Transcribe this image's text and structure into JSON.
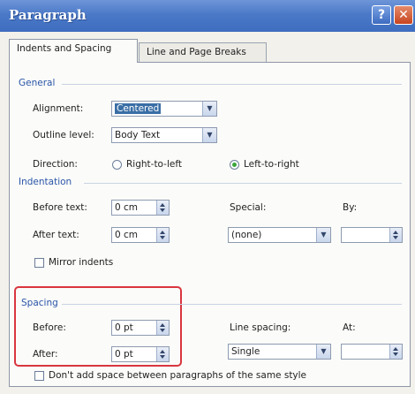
{
  "window": {
    "title": "Paragraph",
    "help_glyph": "?",
    "close_glyph": "✕"
  },
  "tabs": [
    {
      "label": "Indents and Spacing",
      "active": true
    },
    {
      "label": "Line and Page Breaks",
      "active": false
    }
  ],
  "general": {
    "title": "General",
    "alignment_label": "Alignment:",
    "alignment_value": "Centered",
    "outline_label": "Outline level:",
    "outline_value": "Body Text",
    "direction_label": "Direction:",
    "rtl_label": "Right-to-left",
    "ltr_label": "Left-to-right",
    "direction_selected": "Left-to-right"
  },
  "indentation": {
    "title": "Indentation",
    "before_label": "Before text:",
    "before_value": "0 cm",
    "after_label": "After text:",
    "after_value": "0 cm",
    "special_label": "Special:",
    "special_value": "(none)",
    "by_label": "By:",
    "by_value": "",
    "mirror_label": "Mirror indents"
  },
  "spacing": {
    "title": "Spacing",
    "before_label": "Before:",
    "before_value": "0 pt",
    "after_label": "After:",
    "after_value": "0 pt",
    "line_spacing_label": "Line spacing:",
    "line_spacing_value": "Single",
    "at_label": "At:",
    "at_value": "",
    "dont_add_label": "Don't add space between paragraphs of the same style"
  },
  "colors": {
    "title_bar": "#4b79c8",
    "section_title": "#2a55a8",
    "highlight_box": "#d9363e"
  }
}
